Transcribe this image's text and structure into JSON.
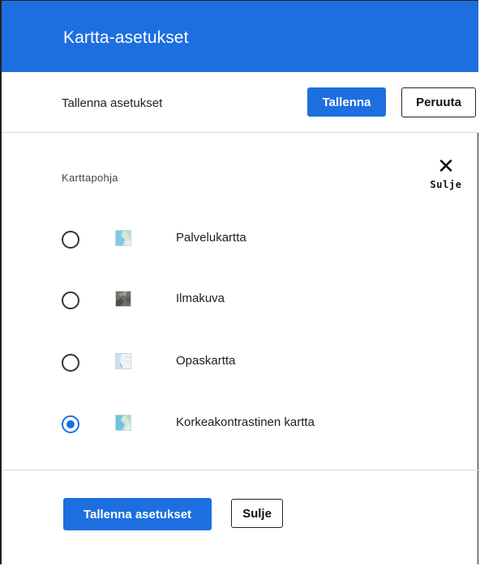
{
  "dialog": {
    "title": "Kartta-asetukset"
  },
  "savebar": {
    "label": "Tallenna asetukset",
    "save_label": "Tallenna",
    "cancel_label": "Peruuta"
  },
  "basemap": {
    "section_label": "Karttapohja",
    "close_label": "Sulje",
    "close_icon": "close-icon",
    "options": [
      {
        "label": "Palvelukartta",
        "selected": false,
        "thumb_icon": "map-thumbnail-icon"
      },
      {
        "label": "Ilmakuva",
        "selected": false,
        "thumb_icon": "aerial-thumbnail-icon"
      },
      {
        "label": "Opaskartta",
        "selected": false,
        "thumb_icon": "guide-map-thumbnail-icon"
      },
      {
        "label": "Korkeakontrastinen kartta",
        "selected": true,
        "thumb_icon": "high-contrast-thumbnail-icon"
      }
    ]
  },
  "footer": {
    "save_label": "Tallenna asetukset",
    "close_label": "Sulje"
  },
  "colors": {
    "accent": "#1d6fe0",
    "header_text": "#ffffff"
  }
}
